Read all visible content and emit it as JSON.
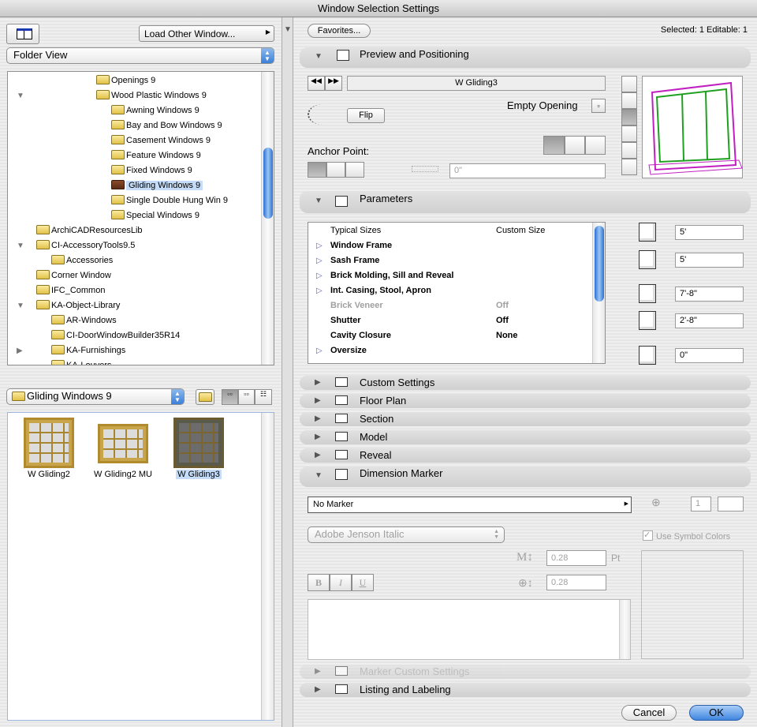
{
  "window": {
    "title": "Window Selection Settings"
  },
  "left": {
    "load_other_window": "Load Other Window...",
    "view_select": "Folder View",
    "tree": [
      {
        "label": "Openings 9",
        "indent": 3,
        "toggle": ""
      },
      {
        "label": "Wood Plastic Windows 9",
        "indent": 3,
        "toggle": "▼"
      },
      {
        "label": "Awning Windows 9",
        "indent": 4,
        "toggle": ""
      },
      {
        "label": "Bay and Bow Windows 9",
        "indent": 4,
        "toggle": ""
      },
      {
        "label": "Casement Windows 9",
        "indent": 4,
        "toggle": ""
      },
      {
        "label": "Feature Windows 9",
        "indent": 4,
        "toggle": ""
      },
      {
        "label": "Fixed Windows 9",
        "indent": 4,
        "toggle": ""
      },
      {
        "label": "Gliding Windows 9",
        "indent": 4,
        "toggle": "",
        "selected": true
      },
      {
        "label": "Single Double Hung Win 9",
        "indent": 4,
        "toggle": ""
      },
      {
        "label": "Special Windows 9",
        "indent": 4,
        "toggle": ""
      },
      {
        "label": "ArchiCADResourcesLib",
        "indent": 0,
        "toggle": ""
      },
      {
        "label": "CI-AccessoryTools9.5",
        "indent": 0,
        "toggle": "▼"
      },
      {
        "label": "Accessories",
        "indent": 1,
        "toggle": ""
      },
      {
        "label": "Corner Window",
        "indent": 0,
        "toggle": ""
      },
      {
        "label": "IFC_Common",
        "indent": 0,
        "toggle": ""
      },
      {
        "label": "KA-Object-Library",
        "indent": 0,
        "toggle": "▼"
      },
      {
        "label": "AR-Windows",
        "indent": 1,
        "toggle": ""
      },
      {
        "label": "CI-DoorWindowBuilder35R14",
        "indent": 1,
        "toggle": ""
      },
      {
        "label": "KA-Furnishings",
        "indent": 1,
        "toggle": "▶"
      },
      {
        "label": "KA-Louvers",
        "indent": 1,
        "toggle": ""
      }
    ],
    "folder_select": "Gliding Windows 9",
    "thumbnails": [
      {
        "label": "W Gliding2",
        "selected": false
      },
      {
        "label": "W Gliding2 MU",
        "selected": false
      },
      {
        "label": "W Gliding3",
        "selected": true
      }
    ]
  },
  "right": {
    "favorites": "Favorites...",
    "selection_status": "Selected: 1 Editable: 1",
    "sections": {
      "preview": "Preview and Positioning",
      "parameters": "Parameters",
      "custom": "Custom Settings",
      "floor_plan": "Floor Plan",
      "section": "Section",
      "model": "Model",
      "reveal": "Reveal",
      "dimension_marker": "Dimension Marker",
      "marker_custom": "Marker Custom Settings",
      "listing": "Listing and Labeling"
    },
    "preview": {
      "prev": "◀◀",
      "next": "▶▶",
      "object_name": "W Gliding3",
      "empty_opening": "Empty Opening",
      "flip": "Flip",
      "anchor_point": "Anchor Point:",
      "offset_value": "0\""
    },
    "parameters": {
      "rows": [
        {
          "name": "Typical Sizes",
          "value": "Custom Size",
          "bold": false,
          "expandable": false,
          "disabled": false
        },
        {
          "name": "Window Frame",
          "value": "",
          "bold": true,
          "expandable": true,
          "disabled": false
        },
        {
          "name": "Sash Frame",
          "value": "",
          "bold": true,
          "expandable": true,
          "disabled": false
        },
        {
          "name": "Brick Molding, Sill and Reveal",
          "value": "",
          "bold": true,
          "expandable": true,
          "disabled": false
        },
        {
          "name": "Int. Casing, Stool, Apron",
          "value": "",
          "bold": true,
          "expandable": true,
          "disabled": false
        },
        {
          "name": "Brick Veneer",
          "value": "Off",
          "bold": true,
          "expandable": false,
          "disabled": true
        },
        {
          "name": "Shutter",
          "value": "Off",
          "bold": true,
          "expandable": false,
          "disabled": false
        },
        {
          "name": "Cavity Closure",
          "value": "None",
          "bold": true,
          "expandable": false,
          "disabled": false
        },
        {
          "name": "Oversize",
          "value": "",
          "bold": true,
          "expandable": true,
          "disabled": false
        }
      ],
      "width": "5'",
      "height": "5'",
      "head_height": "7'-8\"",
      "sill_height": "2'-8\"",
      "reveal_depth": "0\""
    },
    "dimension_marker": {
      "marker_select": "No Marker",
      "pen_value": "1",
      "font_select": "Adobe Jenson Italic",
      "use_symbol_colors": "Use Symbol Colors",
      "use_symbol_colors_checked": true,
      "text_size": "0.28",
      "unit": "Pt",
      "marker_size": "0.28",
      "bold": "B",
      "italic": "I",
      "underline": "U"
    },
    "cancel": "Cancel",
    "ok": "OK"
  },
  "colors": {
    "accent": "#3b7fd8",
    "selection": "#c5dcf8"
  }
}
